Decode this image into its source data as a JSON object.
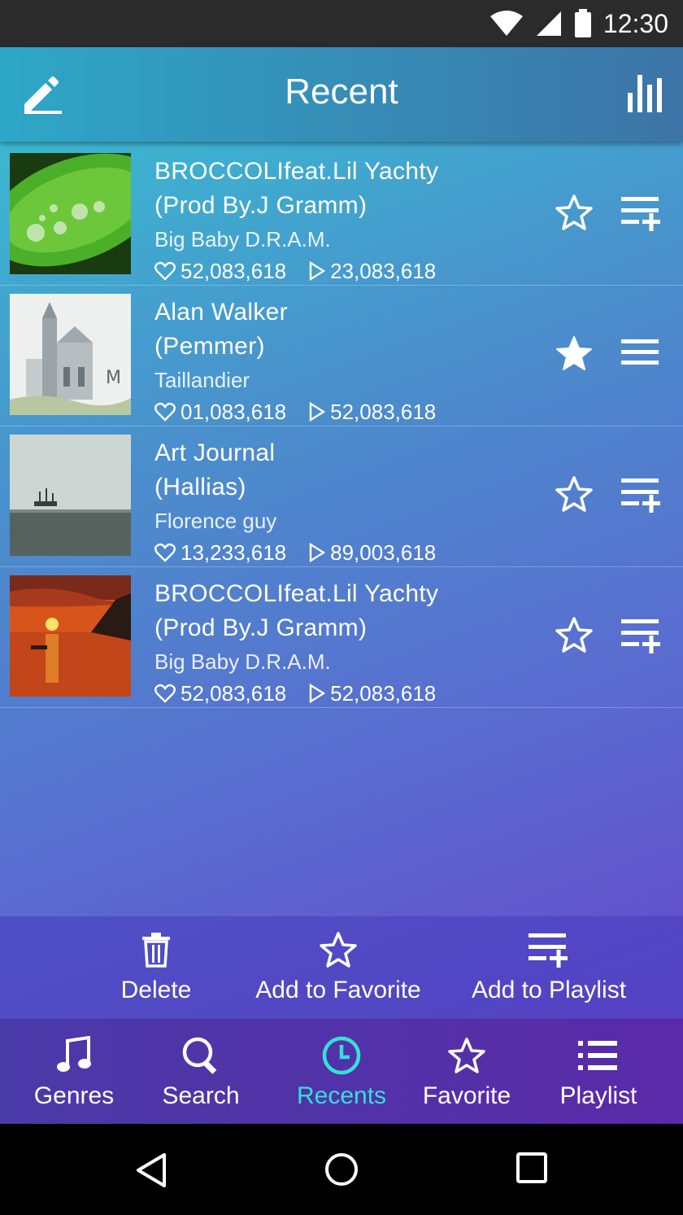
{
  "status": {
    "time": "12:30",
    "icons": [
      "wifi-icon",
      "signal-icon",
      "battery-icon"
    ]
  },
  "header": {
    "title": "Recent"
  },
  "songs": [
    {
      "title_line1": "BROCCOLIfeat.Lil Yachty",
      "title_line2": "(Prod By.J Gramm)",
      "artist": "Big Baby D.R.A.M.",
      "likes": "52,083,618",
      "plays": "23,083,618",
      "favorite": false,
      "action": "add-to-playlist-icon"
    },
    {
      "title_line1": "Alan Walker",
      "title_line2": "(Pemmer)",
      "artist": "Taillandier",
      "likes": "01,083,618",
      "plays": "52,083,618",
      "favorite": true,
      "action": "menu-icon"
    },
    {
      "title_line1": "Art Journal",
      "title_line2": "(Hallias)",
      "artist": "Florence guy",
      "likes": "13,233,618",
      "plays": "89,003,618",
      "favorite": false,
      "action": "add-to-playlist-icon"
    },
    {
      "title_line1": "BROCCOLIfeat.Lil Yachty",
      "title_line2": "(Prod By.J Gramm)",
      "artist": "Big Baby D.R.A.M.",
      "likes": "52,083,618",
      "plays": "52,083,618",
      "favorite": false,
      "action": "add-to-playlist-icon"
    }
  ],
  "actions": {
    "delete": "Delete",
    "add_favorite": "Add to Favorite",
    "add_playlist": "Add to Playlist"
  },
  "nav": {
    "genres": "Genres",
    "search": "Search",
    "recents": "Recents",
    "favorite": "Favorite",
    "playlist": "Playlist"
  },
  "colors": {
    "accent": "#34e0d6",
    "status_bar": "#2b2b2b"
  }
}
